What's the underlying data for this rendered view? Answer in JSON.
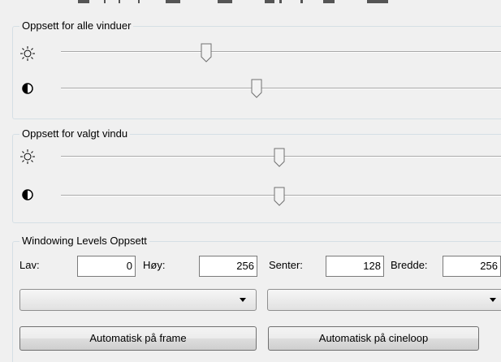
{
  "groups": {
    "all_windows": {
      "title": "Oppsett for alle vinduer",
      "brightness_level": 0.32,
      "contrast_level": 0.43
    },
    "selected_window": {
      "title": "Oppsett for valgt vindu",
      "brightness_level": 0.48,
      "contrast_level": 0.48
    },
    "windowing_levels": {
      "title": "Windowing Levels Oppsett",
      "low_label": "Lav:",
      "low_value": "0",
      "high_label": "Høy:",
      "high_value": "256",
      "center_label": "Senter:",
      "center_value": "128",
      "width_label": "Bredde:",
      "width_value": "256",
      "auto_frame_label": "Automatisk på frame",
      "auto_cineloop_label": "Automatisk på cineloop"
    }
  },
  "icons": {
    "brightness": "sun-icon",
    "contrast": "contrast-icon"
  }
}
